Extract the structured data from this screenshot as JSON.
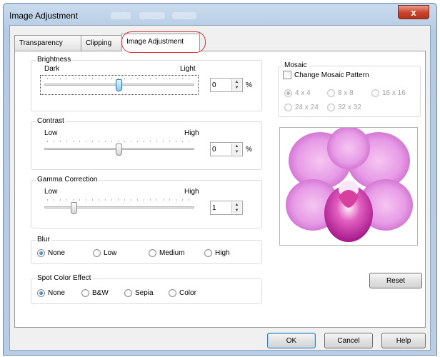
{
  "window": {
    "title": "Image Adjustment",
    "close_glyph": "x"
  },
  "tabs": [
    {
      "label": "Transparency",
      "active": false
    },
    {
      "label": "Clipping",
      "active": false
    },
    {
      "label": "Image Adjustment",
      "active": true
    }
  ],
  "brightness": {
    "label": "Brightness",
    "min_label": "Dark",
    "max_label": "Light",
    "value": "0",
    "unit": "%",
    "level": 0.5
  },
  "contrast": {
    "label": "Contrast",
    "min_label": "Low",
    "max_label": "High",
    "value": "0",
    "unit": "%",
    "level": 0.5
  },
  "gamma": {
    "label": "Gamma Correction",
    "min_label": "Low",
    "max_label": "High",
    "value": "1",
    "level": 0.2
  },
  "blur": {
    "label": "Blur",
    "options": [
      {
        "label": "None",
        "selected": true
      },
      {
        "label": "Low",
        "selected": false
      },
      {
        "label": "Medium",
        "selected": false
      },
      {
        "label": "High",
        "selected": false
      }
    ]
  },
  "spot_color": {
    "label": "Spot Color Effect",
    "options": [
      {
        "label": "None",
        "selected": true
      },
      {
        "label": "B&W",
        "selected": false
      },
      {
        "label": "Sepia",
        "selected": false
      },
      {
        "label": "Color",
        "selected": false
      }
    ]
  },
  "mosaic": {
    "label": "Mosaic",
    "checkbox_label": "Change Mosaic Pattern",
    "checked": false,
    "options": [
      {
        "label": "4 x 4",
        "selected": true
      },
      {
        "label": "8 x 8",
        "selected": false
      },
      {
        "label": "16 x 16",
        "selected": false
      },
      {
        "label": "24 x 24",
        "selected": false
      },
      {
        "label": "32 x 32",
        "selected": false
      }
    ]
  },
  "preview": {
    "icon": "orchid-photo-preview",
    "colors": {
      "petal": "#e79be6",
      "center": "#c52ea5",
      "bg": "#ffffff"
    }
  },
  "buttons": {
    "reset": "Reset",
    "ok": "OK",
    "cancel": "Cancel",
    "help": "Help"
  },
  "colors": {
    "tab_highlight": "#e0303b",
    "titlebar": "#c9dbee"
  }
}
